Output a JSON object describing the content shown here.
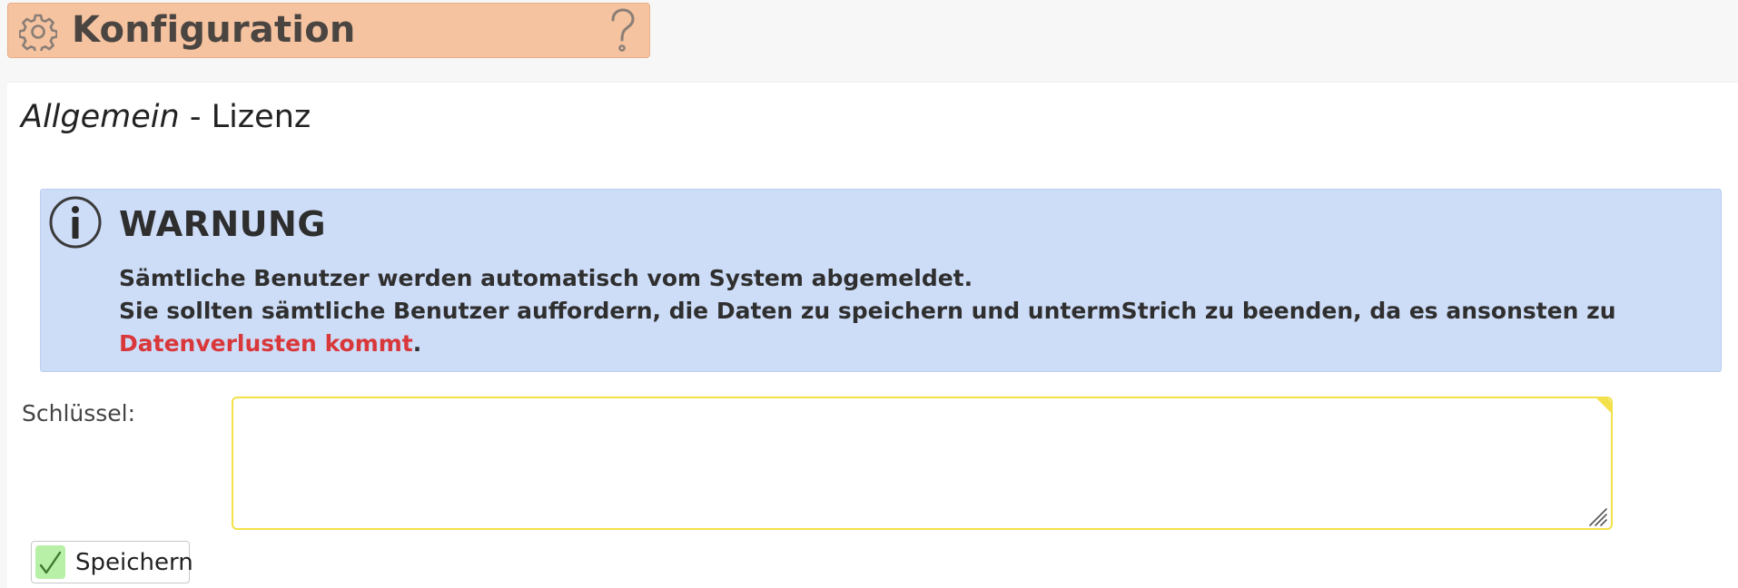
{
  "header": {
    "title": "Konfiguration",
    "icon": "gear-icon",
    "help_icon": "question-mark-icon",
    "background_color": "#f5c3a0"
  },
  "breadcrumb": {
    "section": "Allgemein",
    "separator": " - ",
    "page": "Lizenz"
  },
  "warning": {
    "icon": "info-icon",
    "title": "WARNUNG",
    "line1": "Sämtliche Benutzer werden automatisch vom System abgemeldet.",
    "line2_prefix": "Sie sollten sämtliche Benutzer auffordern, die Daten zu speichern und untermStrich zu beenden, da es ansonsten zu ",
    "line2_highlight": "Datenverlusten kommt",
    "line2_suffix": ".",
    "background_color": "#cddcf7",
    "highlight_color": "#d9383a"
  },
  "form": {
    "key_label": "Schlüssel:",
    "key_value": "",
    "input_border_color": "#f2e14a"
  },
  "actions": {
    "save_label": "Speichern",
    "save_icon": "checkmark-icon"
  }
}
